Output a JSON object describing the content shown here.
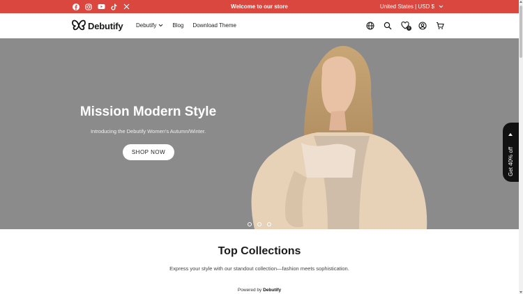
{
  "announcement": {
    "welcome_text": "Welcome to our store",
    "locale_label": "United States | USD $",
    "social_icons": [
      "facebook-icon",
      "instagram-icon",
      "youtube-icon",
      "tiktok-icon",
      "x-icon"
    ]
  },
  "header": {
    "logo_text": "Debutify",
    "nav": [
      {
        "label": "Debutify",
        "has_dropdown": true
      },
      {
        "label": "Blog"
      },
      {
        "label": "Download Theme"
      }
    ],
    "icons": [
      "globe-icon",
      "search-icon",
      "wishlist-icon",
      "account-icon",
      "cart-icon"
    ],
    "wishlist_count": "0"
  },
  "hero": {
    "title": "Mission Modern Style",
    "subtitle": "Introducing the Debutify Women's Autumn/Winter.",
    "button_label": "SHOP NOW"
  },
  "promo_tab": {
    "label": "Get 40% off"
  },
  "collections": {
    "title": "Top Collections",
    "subtitle": "Express your style with our standout collection—fashion meets sophistication."
  },
  "footer": {
    "powered_prefix": "Powered by",
    "powered_brand": "Debutify"
  },
  "colors": {
    "announcement_bg": "#d9473f",
    "hero_bg": "#8b8b8b",
    "promo_tab_bg": "#111111"
  }
}
